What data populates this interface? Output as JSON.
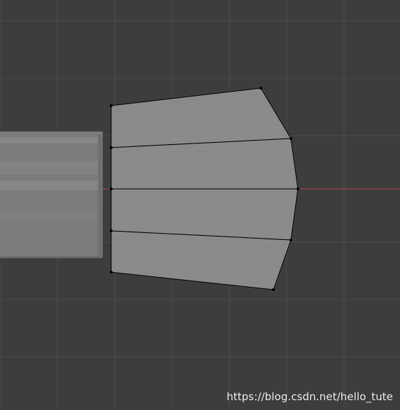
{
  "viewport": {
    "background_color": "#3d3d3d",
    "grid_color": "#4a4a4a",
    "x_axis_color": "#b5494f",
    "cylinder_color": "#7c7e7e",
    "mesh_face_color": "#8a8a8a",
    "mesh_edge_color": "#000000",
    "vertex_color": "#000000"
  },
  "watermark": {
    "text": "https://blog.csdn.net/hello_tute"
  }
}
